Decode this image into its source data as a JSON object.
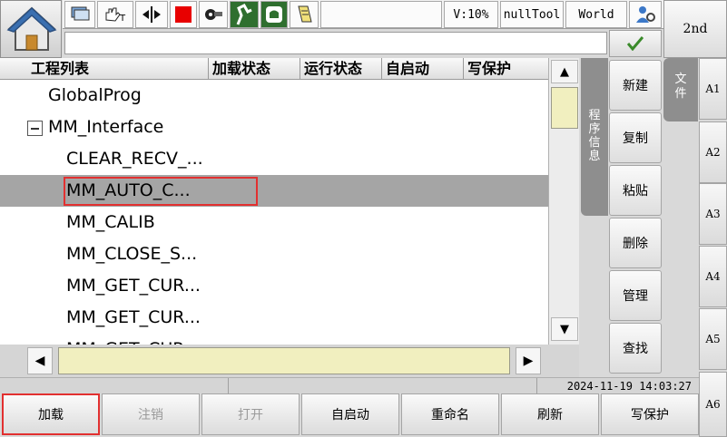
{
  "toolbar": {
    "speed": "V:10%",
    "tool": "nullTool",
    "coord": "World",
    "second_label": "2nd"
  },
  "list": {
    "headers": [
      "工程列表",
      "加载状态",
      "运行状态",
      "自启动",
      "写保护"
    ],
    "rows": [
      {
        "name": "GlobalProg"
      },
      {
        "name": "MM_Interface"
      },
      {
        "name": "CLEAR_RECV_..."
      },
      {
        "name": "MM_AUTO_C..."
      },
      {
        "name": "MM_CALIB"
      },
      {
        "name": "MM_CLOSE_S..."
      },
      {
        "name": "MM_GET_CUR..."
      },
      {
        "name": "MM_GET_CUR..."
      },
      {
        "name": "MM_GET_CUR..."
      }
    ]
  },
  "side": {
    "program_info_tab": "程序信息",
    "file_tab": "文件",
    "buttons": [
      "新建",
      "复制",
      "粘贴",
      "删除",
      "管理",
      "查找"
    ],
    "a_buttons": [
      "A1",
      "A2",
      "A3",
      "A4",
      "A5",
      "A6"
    ]
  },
  "status": {
    "datetime": "2024-11-19 14:03:27"
  },
  "bottom": {
    "buttons": [
      "加载",
      "注销",
      "打开",
      "自启动",
      "重命名",
      "刷新",
      "写保护"
    ]
  }
}
